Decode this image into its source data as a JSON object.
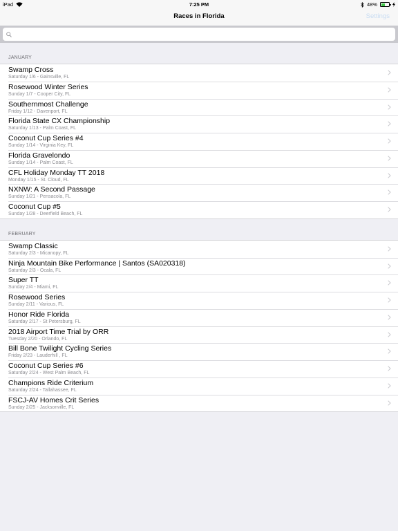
{
  "status_bar": {
    "device": "iPad",
    "time": "7:25 PM",
    "battery": "48%",
    "battery_level": 0.48
  },
  "nav": {
    "title": "Races in Florida",
    "settings": "Settings"
  },
  "search": {
    "placeholder": ""
  },
  "sections": [
    {
      "header": "JANUARY",
      "races": [
        {
          "name": "Swamp Cross",
          "detail": "Saturday 1/6 - Gainsville, FL"
        },
        {
          "name": "Rosewood Winter Series",
          "detail": "Sunday 1/7 - Cooper City, FL"
        },
        {
          "name": "Southernmost Challenge",
          "detail": "Friday 1/12 - Davenport, FL"
        },
        {
          "name": "Florida State CX Championship",
          "detail": "Saturday 1/13 - Palm Coast, FL"
        },
        {
          "name": "Coconut Cup Series #4",
          "detail": "Sunday 1/14 - Virginia Key, FL"
        },
        {
          "name": "Florida Gravelondo",
          "detail": "Sunday 1/14 - Palm Coast, FL"
        },
        {
          "name": "CFL Holiday Monday TT 2018",
          "detail": "Monday 1/15 - St. Cloud, FL"
        },
        {
          "name": "NXNW: A Second Passage",
          "detail": "Sunday 1/21 - Pensacola, FL"
        },
        {
          "name": "Coconut Cup #5",
          "detail": "Sunday 1/28 - Deerfield Beach, FL"
        }
      ]
    },
    {
      "header": "FEBRUARY",
      "races": [
        {
          "name": "Swamp Classic",
          "detail": "Saturday 2/3 - Micanopy, FL"
        },
        {
          "name": "Ninja Mountain Bike Performance | Santos (SA020318)",
          "detail": "Saturday 2/3 - Ocala, FL"
        },
        {
          "name": "Super TT",
          "detail": "Sunday 2/4 - Miami, FL"
        },
        {
          "name": "Rosewood Series",
          "detail": "Sunday 2/11 - Various, FL"
        },
        {
          "name": "Honor Ride Florida",
          "detail": "Saturday 2/17 - St Petersburg, FL"
        },
        {
          "name": "2018 Airport Time Trial by ORR",
          "detail": "Tuesday 2/20 - Orlando, FL"
        },
        {
          "name": "Bill Bone Twilight Cycling Series",
          "detail": "Friday 2/23 - Lauderhill , FL"
        },
        {
          "name": "Coconut Cup Series #6",
          "detail": "Saturday 2/24 - West Palm Beach, FL"
        },
        {
          "name": "Champions Ride Criterium",
          "detail": "Saturday 2/24 - Tallahassee, FL"
        },
        {
          "name": "FSCJ-AV Homes Crit Series",
          "detail": "Sunday 2/25 - Jacksonville, FL"
        }
      ]
    }
  ]
}
